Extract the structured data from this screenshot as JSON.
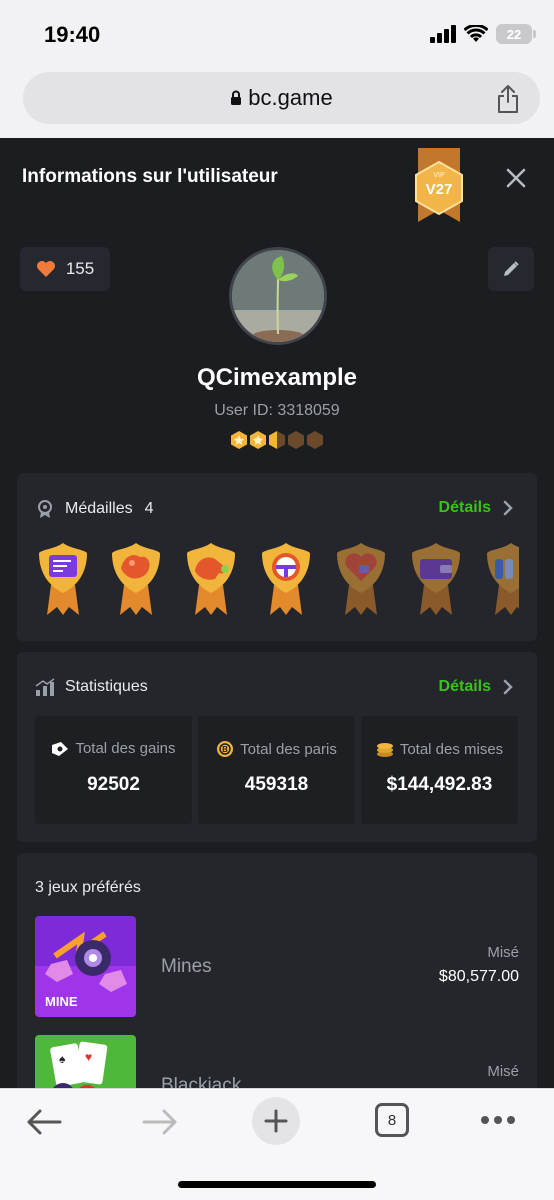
{
  "status_bar": {
    "time": "19:40",
    "battery": "22"
  },
  "browser": {
    "url": "bc.game",
    "tab_count": "8"
  },
  "header": {
    "title": "Informations sur l'utilisateur",
    "vip_small": "VIP",
    "vip_level": "V27"
  },
  "profile": {
    "likes": "155",
    "username": "QCimexample",
    "user_id": "User ID: 3318059",
    "star_rating": 2.5,
    "star_total": 5
  },
  "medals": {
    "title": "Médailles",
    "count": "4",
    "details": "Détails",
    "items": [
      {
        "icon": "chat-medal-icon",
        "earned": true
      },
      {
        "icon": "gift-medal-icon",
        "earned": true
      },
      {
        "icon": "hand-medal-icon",
        "earned": true
      },
      {
        "icon": "wheel-medal-icon",
        "earned": true
      },
      {
        "icon": "heart-medal-icon",
        "earned": false
      },
      {
        "icon": "wallet-medal-icon",
        "earned": false
      },
      {
        "icon": "coin-medal-icon",
        "earned": false
      }
    ]
  },
  "stats": {
    "title": "Statistiques",
    "details": "Détails",
    "items": [
      {
        "label": "Total des gains",
        "value": "92502",
        "icon": "ticket-icon"
      },
      {
        "label": "Total des paris",
        "value": "459318",
        "icon": "coin-icon"
      },
      {
        "label": "Total des mises",
        "value": "$144,492.83",
        "icon": "coin-stack-icon"
      }
    ]
  },
  "favorites": {
    "title": "3 jeux préférés",
    "games": [
      {
        "name": "Mines",
        "bet_label": "Misé",
        "bet": "$80,577.00",
        "thumb_label": "MINE"
      },
      {
        "name": "Blackjack",
        "bet_label": "Misé",
        "bet": ""
      }
    ]
  },
  "colors": {
    "accent_green": "#3bc117",
    "background": "#1b1d21",
    "card": "#24262b",
    "gold": "#f1b53b"
  }
}
